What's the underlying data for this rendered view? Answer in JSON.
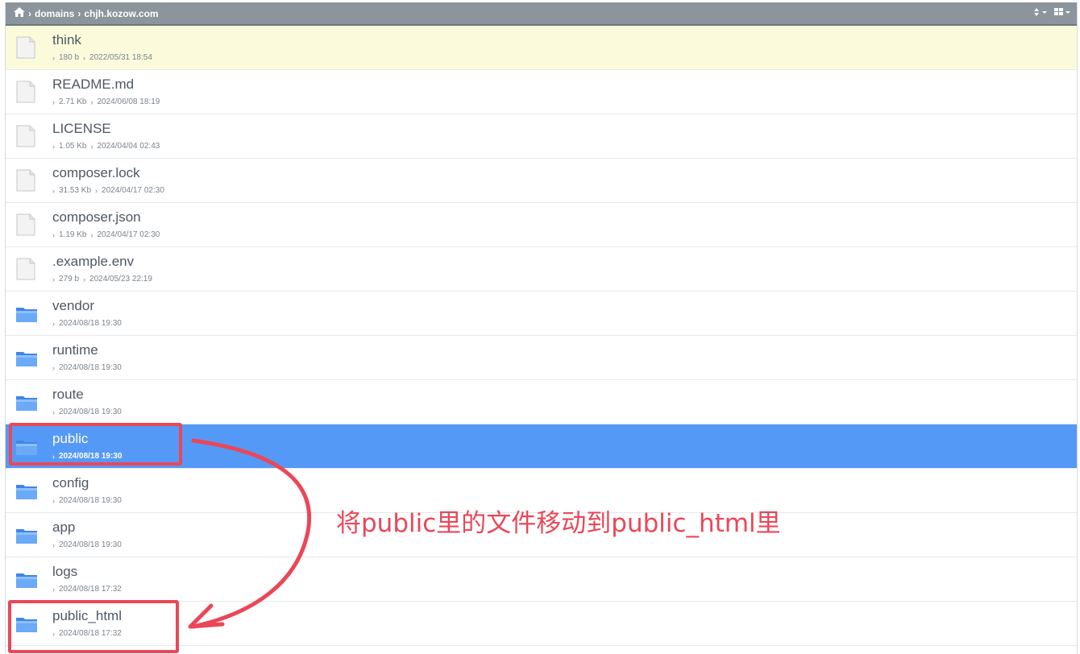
{
  "breadcrumb": [
    "domains",
    "chjh.kozow.com"
  ],
  "toolbar": {
    "sort_icon": "sort-icon",
    "view_icon": "grid-view-icon"
  },
  "files": [
    {
      "name": "think",
      "type": "file",
      "size": "180 b",
      "date": "2022/05/31 18:54",
      "state": "highlighted"
    },
    {
      "name": "README.md",
      "type": "file",
      "size": "2.71 Kb",
      "date": "2024/06/08 18:19"
    },
    {
      "name": "LICENSE",
      "type": "file",
      "size": "1.05 Kb",
      "date": "2024/04/04 02:43"
    },
    {
      "name": "composer.lock",
      "type": "file",
      "size": "31.53 Kb",
      "date": "2024/04/17 02:30"
    },
    {
      "name": "composer.json",
      "type": "file",
      "size": "1.19 Kb",
      "date": "2024/04/17 02:30"
    },
    {
      "name": ".example.env",
      "type": "file",
      "size": "279 b",
      "date": "2024/05/23 22:19"
    },
    {
      "name": "vendor",
      "type": "folder",
      "date": "2024/08/18 19:30"
    },
    {
      "name": "runtime",
      "type": "folder",
      "date": "2024/08/18 19:30"
    },
    {
      "name": "route",
      "type": "folder",
      "date": "2024/08/18 19:30"
    },
    {
      "name": "public",
      "type": "folder",
      "date": "2024/08/18 19:30",
      "state": "selected"
    },
    {
      "name": "config",
      "type": "folder",
      "date": "2024/08/18 19:30"
    },
    {
      "name": "app",
      "type": "folder",
      "date": "2024/08/18 19:30"
    },
    {
      "name": "logs",
      "type": "folder",
      "date": "2024/08/18 17:32"
    },
    {
      "name": "public_html",
      "type": "folder",
      "date": "2024/08/18 17:32"
    }
  ],
  "annotation": {
    "text": "将public里的文件移动到public_html里",
    "color": "#ea4758"
  },
  "colors": {
    "selected": "#5599f7",
    "highlight": "#fbfbdc",
    "header": "#8c949c"
  }
}
